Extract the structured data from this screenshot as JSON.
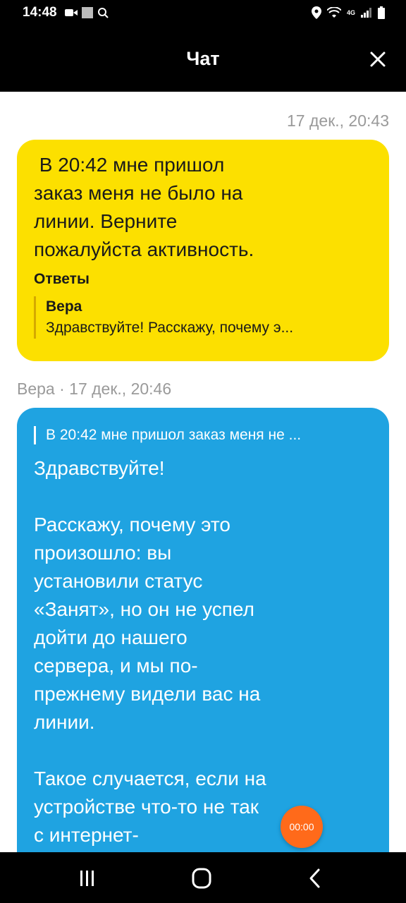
{
  "status_bar": {
    "time": "14:48",
    "network_label": "4G",
    "left_icons": [
      "video-icon",
      "image-icon",
      "search-icon"
    ],
    "right_icons": [
      "location-icon",
      "wifi-icon",
      "signal-icon",
      "battery-icon"
    ]
  },
  "header": {
    "title": "Чат",
    "close_icon": "close-icon"
  },
  "messages": {
    "outgoing": {
      "timestamp": "17 дек., 20:43",
      "text": " В 20:42 мне пришол\nзаказ меня не было на\nлинии. Верните\nпожалуйста активность.",
      "replies_label": "Ответы",
      "reply_author": "Вера",
      "reply_preview": "Здравствуйте! Расскажу, почему э..."
    },
    "incoming": {
      "meta": "Вера · 17 дек., 20:46",
      "quoted": "В 20:42 мне пришол заказ меня не ...",
      "text": "Здравствуйте!\n\nРасскажу, почему это\nпроизошло: вы\nустановили статус\n«Занят», но он не успел\nдойти до нашего\nсервера, и мы по-\nпрежнему видели вас на\nлинии.\n\nТакое случается, если на\nустройстве что-то не так\nс интернет-"
    }
  },
  "timer": {
    "label": "00:00"
  },
  "colors": {
    "outgoing_bubble": "#fce000",
    "incoming_bubble": "#1fa3e1",
    "timer": "#ff6a1a"
  },
  "nav_bar": {
    "icons": [
      "recent-apps-icon",
      "home-icon",
      "back-icon"
    ]
  }
}
